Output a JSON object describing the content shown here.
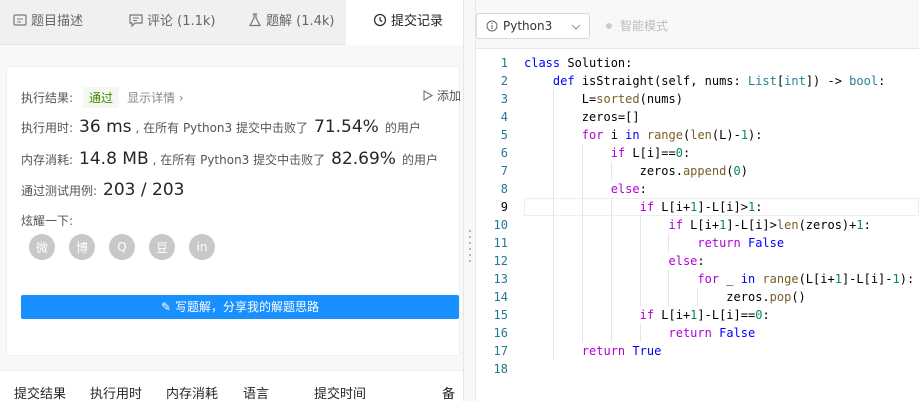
{
  "tabs": [
    {
      "label": "题目描述",
      "icon": "description-icon"
    },
    {
      "label": "评论 (1.1k)",
      "icon": "comment-icon"
    },
    {
      "label": "题解 (1.4k)",
      "icon": "flask-icon"
    },
    {
      "label": "提交记录",
      "icon": "clock-icon"
    }
  ],
  "result": {
    "label": "执行结果:",
    "status": "通过",
    "detail_link": "显示详情",
    "add_note": "添加",
    "runtime_label": "执行用时:",
    "runtime_value": "36 ms",
    "runtime_text": ", 在所有 Python3 提交中击败了",
    "runtime_pct": "71.54%",
    "runtime_suffix": "的用户",
    "memory_label": "内存消耗:",
    "memory_value": "14.8 MB",
    "memory_text": ", 在所有 Python3 提交中击败了",
    "memory_pct": "82.69%",
    "memory_suffix": "的用户",
    "tests_label": "通过测试用例:",
    "tests_value": "203 / 203",
    "share_label": "炫耀一下:",
    "share_icons": [
      "wechat-icon",
      "weibo-icon",
      "qq-icon",
      "douban-icon",
      "linkedin-icon"
    ],
    "share_glyphs": [
      "微",
      "博",
      "Q",
      "豆",
      "in"
    ],
    "write_button": "写题解，分享我的解题思路"
  },
  "table_headers": [
    "提交结果",
    "执行用时",
    "内存消耗",
    "语言",
    "提交时间",
    "备"
  ],
  "editor": {
    "language": "Python3",
    "smart_mode": "智能模式",
    "active_line": 9,
    "lines": [
      "class Solution:",
      "    def isStraight(self, nums: List[int]) -> bool:",
      "        L=sorted(nums)",
      "        zeros=[]",
      "        for i in range(len(L)-1):",
      "            if L[i]==0:",
      "                zeros.append(0)",
      "            else:",
      "                if L[i+1]-L[i]>1:",
      "                    if L[i+1]-L[i]>len(zeros)+1:",
      "                        return False",
      "                    else:",
      "                        for _ in range(L[i+1]-L[i]-1):",
      "                            zeros.pop()",
      "                if L[i+1]-L[i]==0:",
      "                    return False",
      "        return True",
      ""
    ]
  },
  "colors": {
    "accent": "#1890ff",
    "pass": "#3c8a00",
    "keyword": "#0000ff",
    "control": "#af00db"
  }
}
